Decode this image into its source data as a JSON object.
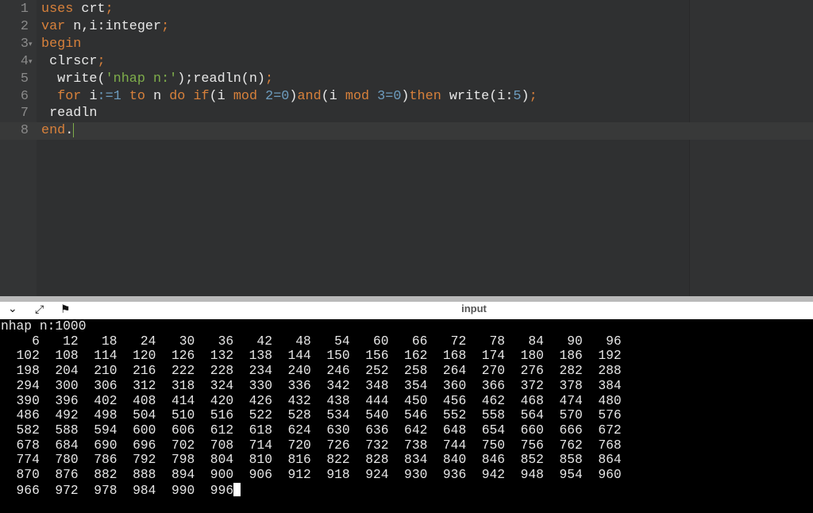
{
  "editor": {
    "lines": [
      {
        "n": "1",
        "fold": false,
        "tokens": [
          [
            "uses",
            "kw"
          ],
          [
            " crt",
            ""
          ],
          [
            ";",
            "pun"
          ]
        ]
      },
      {
        "n": "2",
        "fold": false,
        "tokens": [
          [
            "var",
            "kw"
          ],
          [
            " n,i:integer",
            ""
          ],
          [
            ";",
            "pun"
          ]
        ]
      },
      {
        "n": "3",
        "fold": true,
        "tokens": [
          [
            "begin",
            "kw"
          ]
        ]
      },
      {
        "n": "4",
        "fold": true,
        "tokens": [
          [
            " clrscr",
            ""
          ],
          [
            ";",
            "pun"
          ]
        ]
      },
      {
        "n": "5",
        "fold": false,
        "tokens": [
          [
            "  write(",
            ""
          ],
          [
            "'nhap n:'",
            "str"
          ],
          [
            ");readln(n)",
            ""
          ],
          [
            ";",
            "pun"
          ]
        ]
      },
      {
        "n": "6",
        "fold": false,
        "tokens": [
          [
            "  ",
            ""
          ],
          [
            "for",
            "kw"
          ],
          [
            " i",
            ""
          ],
          [
            ":=",
            "op"
          ],
          [
            "1",
            "num"
          ],
          [
            " ",
            ""
          ],
          [
            "to",
            "kw"
          ],
          [
            " n ",
            ""
          ],
          [
            "do",
            "kw"
          ],
          [
            " ",
            ""
          ],
          [
            "if",
            "kw"
          ],
          [
            "(i ",
            ""
          ],
          [
            "mod",
            "kw"
          ],
          [
            " ",
            ""
          ],
          [
            "2",
            "num"
          ],
          [
            "=",
            "op"
          ],
          [
            "0",
            "num"
          ],
          [
            ")",
            ""
          ],
          [
            "and",
            "kw"
          ],
          [
            "(i ",
            ""
          ],
          [
            "mod",
            "kw"
          ],
          [
            " ",
            ""
          ],
          [
            "3",
            "num"
          ],
          [
            "=",
            "op"
          ],
          [
            "0",
            "num"
          ],
          [
            ")",
            ""
          ],
          [
            "then",
            "kw"
          ],
          [
            " write(i:",
            ""
          ],
          [
            "5",
            "num"
          ],
          [
            ")",
            ""
          ],
          [
            ";",
            "pun"
          ]
        ]
      },
      {
        "n": "7",
        "fold": false,
        "tokens": [
          [
            " readln",
            ""
          ]
        ]
      },
      {
        "n": "8",
        "fold": false,
        "tokens": [
          [
            "end",
            "kw"
          ],
          [
            ".",
            ""
          ]
        ]
      }
    ]
  },
  "console": {
    "title": "input",
    "icons": [
      "chevron-down-icon",
      "expand-icon",
      "run-icon"
    ],
    "lines": [
      "nhap n:1000",
      "    6   12   18   24   30   36   42   48   54   60   66   72   78   84   90   96",
      "  102  108  114  120  126  132  138  144  150  156  162  168  174  180  186  192",
      "  198  204  210  216  222  228  234  240  246  252  258  264  270  276  282  288",
      "  294  300  306  312  318  324  330  336  342  348  354  360  366  372  378  384",
      "  390  396  402  408  414  420  426  432  438  444  450  456  462  468  474  480",
      "  486  492  498  504  510  516  522  528  534  540  546  552  558  564  570  576",
      "  582  588  594  600  606  612  618  624  630  636  642  648  654  660  666  672",
      "  678  684  690  696  702  708  714  720  726  732  738  744  750  756  762  768",
      "  774  780  786  792  798  804  810  816  822  828  834  840  846  852  858  864",
      "  870  876  882  888  894  900  906  912  918  924  930  936  942  948  954  960",
      "  966  972  978  984  990  996"
    ]
  }
}
